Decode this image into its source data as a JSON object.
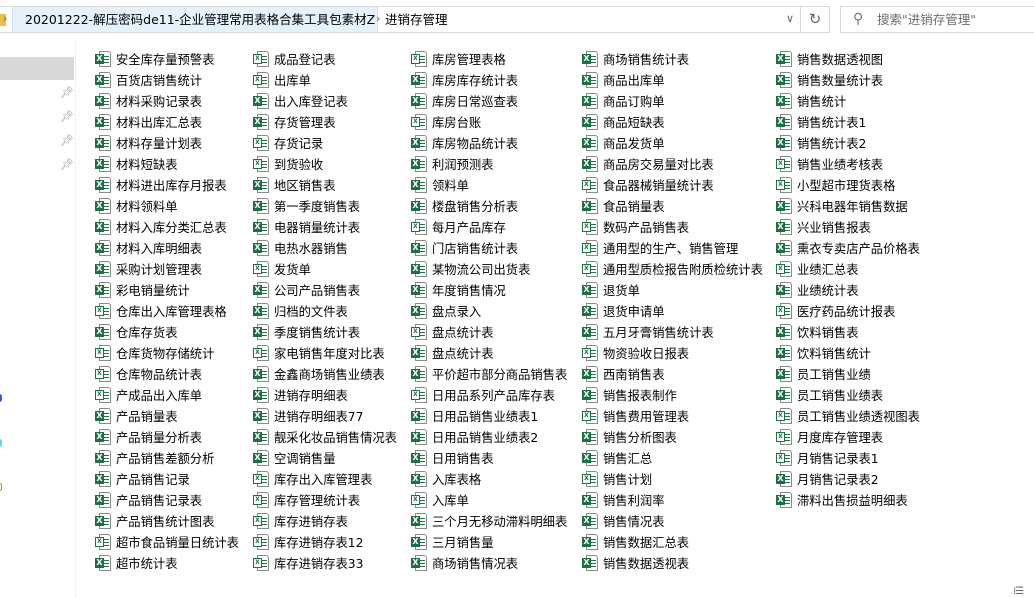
{
  "address_bar": {
    "crumbs": [
      "20201222-解压密码de11-企业管理常用表格合集工具包素材Z",
      "进销存管理"
    ],
    "separator": "›",
    "dropdown_icon": "chevron-down-icon",
    "refresh_icon": "refresh-icon"
  },
  "search": {
    "placeholder": "搜索\"进销存管理\""
  },
  "colors": {
    "excel_green": "#1d7044",
    "crumb_highlight": "#e5f1fb",
    "nav_selected": "#d9d9d9"
  },
  "columns": [
    [
      [
        "安全库存量预警表",
        "x"
      ],
      [
        "百货店销售统计",
        "x"
      ],
      [
        "材料采购记录表",
        "x"
      ],
      [
        "材料出库汇总表",
        "x"
      ],
      [
        "材料存量计划表",
        "x"
      ],
      [
        "材料短缺表",
        "x"
      ],
      [
        "材料进出库存月报表",
        "x"
      ],
      [
        "材料领料单",
        "x"
      ],
      [
        "材料入库分类汇总表",
        "x"
      ],
      [
        "材料入库明细表",
        "x"
      ],
      [
        "采购计划管理表",
        "x"
      ],
      [
        "彩电销量统计",
        "x"
      ],
      [
        "仓库出入库管理表格",
        "o"
      ],
      [
        "仓库存货表",
        "x"
      ],
      [
        "仓库货物存储统计",
        "o"
      ],
      [
        "仓库物品统计表",
        "o"
      ],
      [
        "产成品出入库单",
        "o"
      ],
      [
        "产品销量表",
        "x"
      ],
      [
        "产品销量分析表",
        "x"
      ],
      [
        "产品销售差额分析",
        "x"
      ],
      [
        "产品销售记录",
        "x"
      ],
      [
        "产品销售记录表",
        "x"
      ],
      [
        "产品销售统计图表",
        "x"
      ],
      [
        "超市食品销量日统计表",
        "o"
      ],
      [
        "超市统计表",
        "x"
      ]
    ],
    [
      [
        "成品登记表",
        "o"
      ],
      [
        "出库单",
        "o"
      ],
      [
        "出入库登记表",
        "x"
      ],
      [
        "存货管理表",
        "x"
      ],
      [
        "存货记录",
        "o"
      ],
      [
        "到货验收",
        "o"
      ],
      [
        "地区销售表",
        "x"
      ],
      [
        "第一季度销售表",
        "x"
      ],
      [
        "电器销量统计表",
        "x"
      ],
      [
        "电热水器销售",
        "x"
      ],
      [
        "发货单",
        "o"
      ],
      [
        "公司产品销售表",
        "x"
      ],
      [
        "归档的文件表",
        "x"
      ],
      [
        "季度销售统计表",
        "x"
      ],
      [
        "家电销售年度对比表",
        "o"
      ],
      [
        "金鑫商场销售业绩表",
        "x"
      ],
      [
        "进销存明细表",
        "x"
      ],
      [
        "进销存明细表77",
        "x"
      ],
      [
        "靓采化妆品销售情况表",
        "x"
      ],
      [
        "空调销售量",
        "x"
      ],
      [
        "库存出入库管理表",
        "o"
      ],
      [
        "库存管理统计表",
        "o"
      ],
      [
        "库存进销存表",
        "o"
      ],
      [
        "库存进销存表12",
        "o"
      ],
      [
        "库存进销存表33",
        "o"
      ]
    ],
    [
      [
        "库房管理表格",
        "o"
      ],
      [
        "库房库存统计表",
        "x"
      ],
      [
        "库房日常巡查表",
        "x"
      ],
      [
        "库房台账",
        "o"
      ],
      [
        "库房物品统计表",
        "x"
      ],
      [
        "利润预测表",
        "x"
      ],
      [
        "领料单",
        "x"
      ],
      [
        "楼盘销售分析表",
        "x"
      ],
      [
        "每月产品库存",
        "o"
      ],
      [
        "门店销售统计表",
        "x"
      ],
      [
        "某物流公司出货表",
        "x"
      ],
      [
        "年度销售情况",
        "x"
      ],
      [
        "盘点录入",
        "x"
      ],
      [
        "盘点统计表",
        "o"
      ],
      [
        "盘点统计表",
        "x"
      ],
      [
        "平价超市部分商品销售表",
        "x"
      ],
      [
        "日用品系列产品库存表",
        "o"
      ],
      [
        "日用品销售业绩表1",
        "x"
      ],
      [
        "日用品销售业绩表2",
        "x"
      ],
      [
        "日用销售表",
        "x"
      ],
      [
        "入库表格",
        "x"
      ],
      [
        "入库单",
        "o"
      ],
      [
        "三个月无移动滞料明细表",
        "x"
      ],
      [
        "三月销售量",
        "x"
      ],
      [
        "商场销售情况表",
        "x"
      ]
    ],
    [
      [
        "商场销售统计表",
        "x"
      ],
      [
        "商品出库单",
        "x"
      ],
      [
        "商品订购单",
        "x"
      ],
      [
        "商品短缺表",
        "x"
      ],
      [
        "商品发货单",
        "x"
      ],
      [
        "商品房交易量对比表",
        "x"
      ],
      [
        "食品器械销量统计表",
        "o"
      ],
      [
        "食品销量表",
        "x"
      ],
      [
        "数码产品销售表",
        "o"
      ],
      [
        "通用型的生产、销售管理",
        "o"
      ],
      [
        "通用型质检报告附质检统计表",
        "o"
      ],
      [
        "退货单",
        "x"
      ],
      [
        "退货申请单",
        "x"
      ],
      [
        "五月牙膏销售统计表",
        "x"
      ],
      [
        "物资验收日报表",
        "o"
      ],
      [
        "西南销售表",
        "x"
      ],
      [
        "销售报表制作",
        "x"
      ],
      [
        "销售费用管理表",
        "o"
      ],
      [
        "销售分析图表",
        "x"
      ],
      [
        "销售汇总",
        "x"
      ],
      [
        "销售计划",
        "o"
      ],
      [
        "销售利润率",
        "x"
      ],
      [
        "销售情况表",
        "x"
      ],
      [
        "销售数据汇总表",
        "x"
      ],
      [
        "销售数据透视表",
        "x"
      ]
    ],
    [
      [
        "销售数据透视图",
        "x"
      ],
      [
        "销售数量统计表",
        "x"
      ],
      [
        "销售统计",
        "x"
      ],
      [
        "销售统计表1",
        "x"
      ],
      [
        "销售统计表2",
        "x"
      ],
      [
        "销售业绩考核表",
        "o"
      ],
      [
        "小型超市理货表格",
        "o"
      ],
      [
        "兴科电器年销售数据",
        "x"
      ],
      [
        "兴业销售报表",
        "x"
      ],
      [
        "熏衣专卖店产品价格表",
        "x"
      ],
      [
        "业绩汇总表",
        "o"
      ],
      [
        "业绩统计表",
        "x"
      ],
      [
        "医疗药品统计报表",
        "o"
      ],
      [
        "饮料销售表",
        "x"
      ],
      [
        "饮料销售统计",
        "x"
      ],
      [
        "员工销售业绩",
        "x"
      ],
      [
        "员工销售业绩表",
        "x"
      ],
      [
        "员工销售业绩透视图表",
        "o"
      ],
      [
        "月度库存管理表",
        "o"
      ],
      [
        "月销售记录表1",
        "o"
      ],
      [
        "月销售记录表2",
        "x"
      ],
      [
        "滞料出售损益明细表",
        "x"
      ]
    ]
  ]
}
